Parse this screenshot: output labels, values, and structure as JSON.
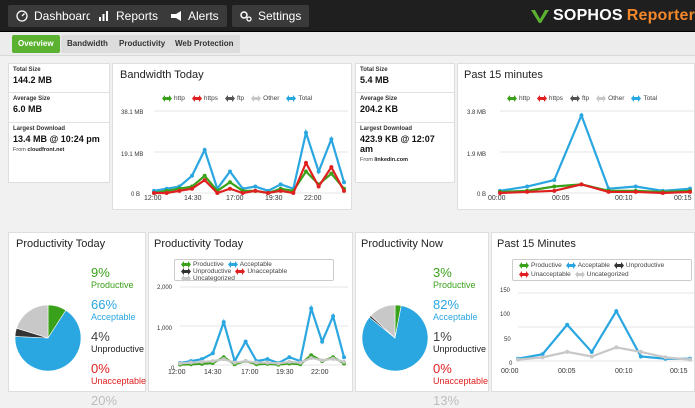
{
  "nav": {
    "dashboard": "Dashboard",
    "reports": "Reports",
    "alerts": "Alerts",
    "settings": "Settings"
  },
  "logo": {
    "part1": "SOPHOS",
    "part2": "Reporter"
  },
  "subtabs": [
    "Overview",
    "Bandwidth",
    "Productivity",
    "Web Protection"
  ],
  "bandwidth_today": {
    "title": "Bandwidth Today",
    "stats": {
      "total_label": "Total Size",
      "total_value": "144.2 MB",
      "avg_label": "Average Size",
      "avg_value": "6.0 MB",
      "largest_label": "Largest Download",
      "largest_value": "13.4 MB @ 10:24 pm",
      "from_prefix": "From",
      "from_host": "cloudfront.net"
    },
    "legend": [
      "http",
      "https",
      "ftp",
      "Other",
      "Total"
    ],
    "yticks": [
      "38.1 MB",
      "19.1 MB",
      "0 B"
    ],
    "xticks": [
      "12:00",
      "14:30",
      "17:00",
      "19:30",
      "22:00"
    ]
  },
  "past15_bw": {
    "title": "Past 15 minutes",
    "stats": {
      "total_label": "Total Size",
      "total_value": "5.4 MB",
      "avg_label": "Average Size",
      "avg_value": "204.2 KB",
      "largest_label": "Largest Download",
      "largest_value": "423.9 KB @ 12:07 am",
      "from_prefix": "From",
      "from_host": "linkedin.com"
    },
    "legend": [
      "http",
      "https",
      "ftp",
      "Other",
      "Total"
    ],
    "yticks": [
      "3.8 MB",
      "1.9 MB",
      "0 B"
    ],
    "xticks": [
      "00:00",
      "00:05",
      "00:10",
      "00:15"
    ]
  },
  "productivity_today_pie": {
    "title": "Productivity Today",
    "items": [
      {
        "pct": "9%",
        "label": "Productive",
        "color": "#3aa21a"
      },
      {
        "pct": "66%",
        "label": "Acceptable",
        "color": "#2aa6e0"
      },
      {
        "pct": "4%",
        "label": "Unproductive",
        "color": "#333333"
      },
      {
        "pct": "0%",
        "label": "Unacceptable",
        "color": "#e02020"
      },
      {
        "pct": "20%",
        "label": "",
        "color": "#c8c8c8"
      }
    ]
  },
  "productivity_today_line": {
    "title": "Productivity Today",
    "legend": [
      "Productive",
      "Acceptable",
      "Unproductive",
      "Unacceptable",
      "Uncategorized"
    ],
    "yticks": [
      "2,000",
      "1,000",
      "0"
    ],
    "xticks": [
      "12:00",
      "14:30",
      "17:00",
      "19:30",
      "22:00"
    ]
  },
  "productivity_now_pie": {
    "title": "Productivity Now",
    "items": [
      {
        "pct": "3%",
        "label": "Productive",
        "color": "#3aa21a"
      },
      {
        "pct": "82%",
        "label": "Acceptable",
        "color": "#2aa6e0"
      },
      {
        "pct": "1%",
        "label": "Unproductive",
        "color": "#333333"
      },
      {
        "pct": "0%",
        "label": "Unacceptable",
        "color": "#e02020"
      },
      {
        "pct": "13%",
        "label": "",
        "color": "#c8c8c8"
      }
    ]
  },
  "past15_prod": {
    "title": "Past 15 Minutes",
    "legend": [
      "Productive",
      "Acceptable",
      "Unproductive",
      "Unacceptable",
      "Uncategorized"
    ],
    "yticks": [
      "150",
      "100",
      "50",
      "0"
    ],
    "xticks": [
      "00:00",
      "00:05",
      "00:10",
      "00:15"
    ]
  },
  "colors": {
    "http": "#3aa21a",
    "https": "#e02020",
    "ftp": "#555555",
    "other": "#c8c8c8",
    "total": "#2aa6e0",
    "active_tab": "#5bb231",
    "logo_accent": "#f2862a"
  },
  "chart_data": [
    {
      "type": "line",
      "title": "Bandwidth Today",
      "x": [
        "12:00",
        "14:30",
        "17:00",
        "19:30",
        "22:00"
      ],
      "ylim": [
        0,
        38.1
      ],
      "series": [
        {
          "name": "Total",
          "values": [
            1,
            2,
            3,
            8,
            20,
            2,
            10,
            2,
            3,
            1,
            4,
            2,
            28,
            10,
            25,
            5
          ]
        },
        {
          "name": "http",
          "values": [
            0,
            1,
            2,
            3,
            8,
            1,
            5,
            1,
            1,
            0,
            2,
            1,
            10,
            4,
            9,
            2
          ]
        },
        {
          "name": "https",
          "values": [
            0,
            0,
            1,
            2,
            6,
            0,
            2,
            0,
            1,
            0,
            1,
            0,
            14,
            3,
            12,
            1
          ]
        }
      ]
    },
    {
      "type": "line",
      "title": "Past 15 minutes",
      "x": [
        "00:00",
        "00:05",
        "00:10",
        "00:15"
      ],
      "ylim": [
        0,
        3.8
      ],
      "series": [
        {
          "name": "Total",
          "values": [
            0.1,
            0.3,
            0.6,
            3.6,
            0.2,
            0.3,
            0.1,
            0.2
          ]
        },
        {
          "name": "http",
          "values": [
            0.05,
            0.1,
            0.3,
            0.4,
            0.1,
            0.1,
            0.05,
            0.1
          ]
        },
        {
          "name": "https",
          "values": [
            0,
            0.05,
            0.1,
            0.4,
            0.05,
            0.05,
            0,
            0.05
          ]
        }
      ]
    },
    {
      "type": "pie",
      "title": "Productivity Today",
      "categories": [
        "Productive",
        "Acceptable",
        "Unproductive",
        "Unacceptable",
        "Uncategorized"
      ],
      "values": [
        9,
        66,
        4,
        0,
        20
      ]
    },
    {
      "type": "line",
      "title": "Productivity Today",
      "x": [
        "12:00",
        "14:30",
        "17:00",
        "19:30",
        "22:00"
      ],
      "ylim": [
        0,
        2000
      ],
      "series": [
        {
          "name": "Acceptable",
          "values": [
            50,
            100,
            150,
            300,
            1100,
            100,
            600,
            100,
            150,
            50,
            200,
            100,
            1450,
            600,
            1250,
            200
          ]
        },
        {
          "name": "Productive",
          "values": [
            10,
            20,
            30,
            50,
            200,
            20,
            100,
            20,
            30,
            10,
            40,
            20,
            250,
            100,
            200,
            40
          ]
        },
        {
          "name": "Uncategorized",
          "values": [
            40,
            60,
            80,
            100,
            150,
            60,
            100,
            60,
            60,
            40,
            80,
            60,
            180,
            120,
            160,
            80
          ]
        }
      ]
    },
    {
      "type": "pie",
      "title": "Productivity Now",
      "categories": [
        "Productive",
        "Acceptable",
        "Unproductive",
        "Unacceptable",
        "Uncategorized"
      ],
      "values": [
        3,
        82,
        1,
        0,
        13
      ]
    },
    {
      "type": "line",
      "title": "Past 15 Minutes",
      "x": [
        "00:00",
        "00:05",
        "00:10",
        "00:15"
      ],
      "ylim": [
        0,
        150
      ],
      "series": [
        {
          "name": "Acceptable",
          "values": [
            5,
            15,
            80,
            20,
            110,
            10,
            5,
            5
          ]
        },
        {
          "name": "Uncategorized",
          "values": [
            3,
            8,
            20,
            10,
            30,
            20,
            8,
            3
          ]
        }
      ]
    }
  ]
}
